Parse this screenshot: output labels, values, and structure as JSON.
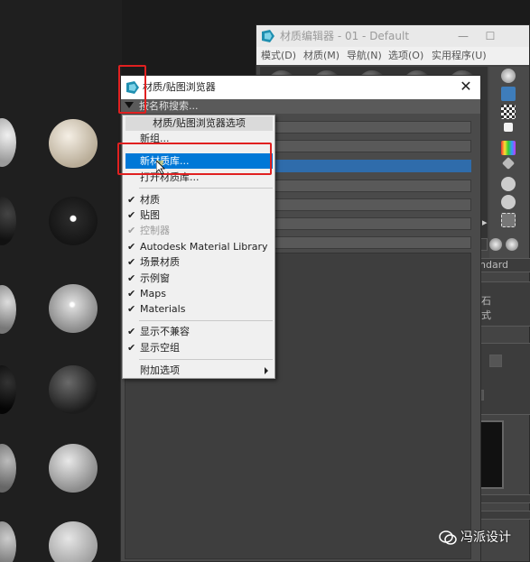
{
  "material_editor": {
    "title": "材质编辑器 - 01 - Default",
    "window_buttons": [
      "—",
      "☐",
      "✕"
    ],
    "menu": [
      "模式(D)",
      "材质(M)",
      "导航(N)",
      "选项(O)",
      "实用程序(U)"
    ],
    "side_labels": [
      "ndard",
      "石",
      "式"
    ]
  },
  "browser": {
    "title": "材质/贴图浏览器",
    "close": "✕",
    "search_placeholder": "按名称搜索..."
  },
  "context_menu": {
    "header": "材质/贴图浏览器选项",
    "items": [
      {
        "label": "新组...",
        "checked": false,
        "disabled": false
      },
      {
        "label": "新材质库...",
        "checked": false,
        "disabled": false,
        "highlighted": true
      },
      {
        "label": "打开材质库...",
        "checked": false,
        "disabled": false
      },
      {
        "label": "材质",
        "checked": true,
        "disabled": false
      },
      {
        "label": "贴图",
        "checked": true,
        "disabled": false
      },
      {
        "label": "控制器",
        "checked": true,
        "disabled": true
      },
      {
        "label": "Autodesk Material Library",
        "checked": true,
        "disabled": false
      },
      {
        "label": "场景材质",
        "checked": true,
        "disabled": false
      },
      {
        "label": "示例窗",
        "checked": true,
        "disabled": false
      },
      {
        "label": "Maps",
        "checked": true,
        "disabled": false
      },
      {
        "label": "Materials",
        "checked": true,
        "disabled": false
      },
      {
        "label": "显示不兼容",
        "checked": true,
        "disabled": false
      },
      {
        "label": "显示空组",
        "checked": true,
        "disabled": false
      },
      {
        "label": "附加选项",
        "checked": false,
        "disabled": false,
        "submenu": true
      }
    ],
    "check_glyph": "✔"
  },
  "watermark": {
    "text": "冯派设计"
  },
  "colors": {
    "highlight": "#0078d7",
    "annotation_red": "#e02020",
    "selected_row": "#2f6cab"
  }
}
